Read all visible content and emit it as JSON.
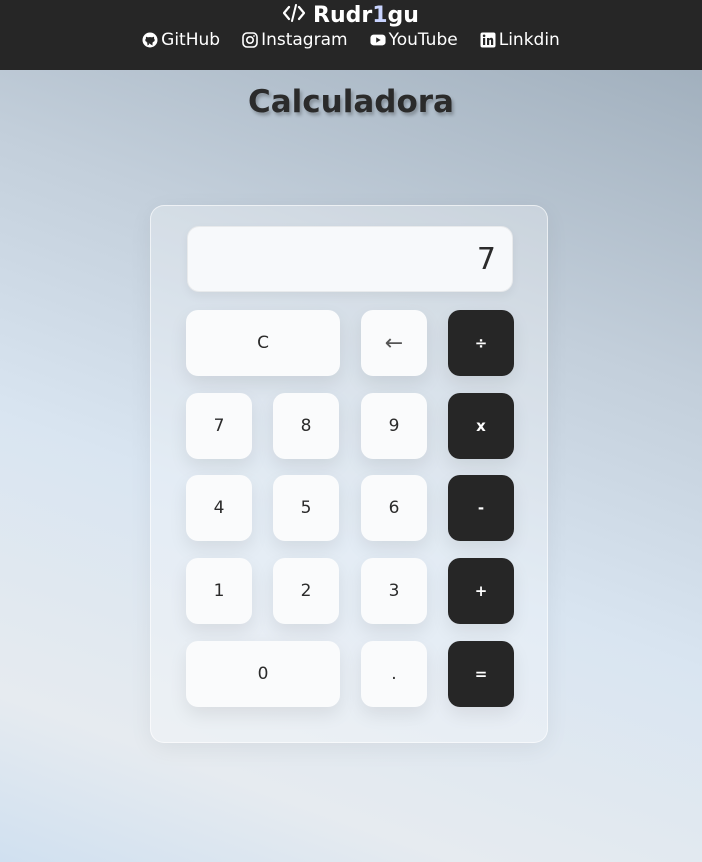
{
  "header": {
    "brand_prefix": "Rudr",
    "brand_highlight": "1",
    "brand_suffix": "gu",
    "links": [
      {
        "label": "GitHub",
        "icon": "github-icon"
      },
      {
        "label": "Instagram",
        "icon": "instagram-icon"
      },
      {
        "label": "YouTube",
        "icon": "youtube-icon"
      },
      {
        "label": "Linkdin",
        "icon": "linkedin-icon"
      }
    ]
  },
  "page": {
    "title": "Calculadora"
  },
  "calculator": {
    "display": "7",
    "keys": {
      "clear": "C",
      "backspace": "←",
      "divide": "÷",
      "seven": "7",
      "eight": "8",
      "nine": "9",
      "multiply": "x",
      "four": "4",
      "five": "5",
      "six": "6",
      "subtract": "-",
      "one": "1",
      "two": "2",
      "three": "3",
      "add": "+",
      "zero": "0",
      "decimal": ".",
      "equals": "="
    }
  },
  "colors": {
    "header_bg": "#262626",
    "operator_bg": "#262626",
    "key_bg": "#fafbfc"
  }
}
